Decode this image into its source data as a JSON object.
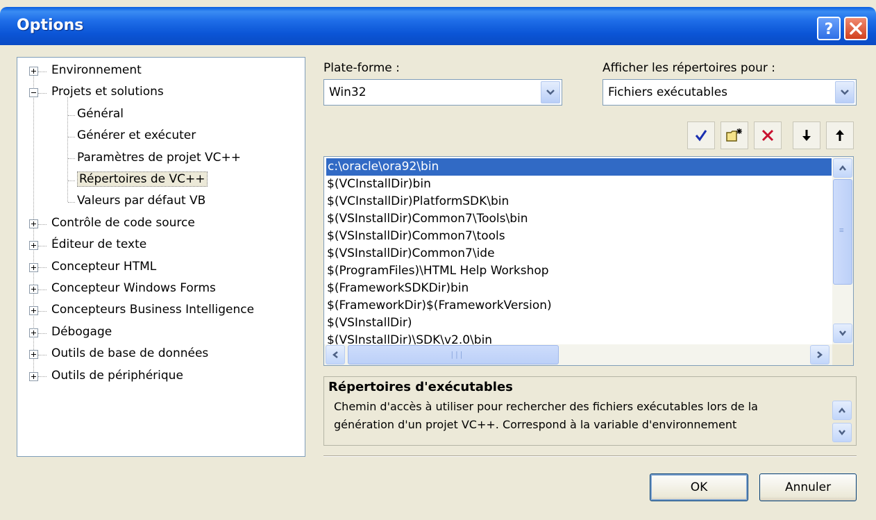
{
  "window": {
    "title": "Options"
  },
  "tree": {
    "items": [
      {
        "label": "Environnement",
        "expander": "plus"
      },
      {
        "label": "Projets et solutions",
        "expander": "minus"
      },
      {
        "label": "Général",
        "expander": "none"
      },
      {
        "label": "Générer et exécuter",
        "expander": "none"
      },
      {
        "label": "Paramètres de projet VC++",
        "expander": "none"
      },
      {
        "label": "Répertoires de VC++",
        "expander": "none",
        "selected": true
      },
      {
        "label": "Valeurs par défaut VB",
        "expander": "none"
      },
      {
        "label": "Contrôle de code source",
        "expander": "plus"
      },
      {
        "label": "Éditeur de texte",
        "expander": "plus"
      },
      {
        "label": "Concepteur HTML",
        "expander": "plus"
      },
      {
        "label": "Concepteur Windows Forms",
        "expander": "plus"
      },
      {
        "label": "Concepteurs Business Intelligence",
        "expander": "plus"
      },
      {
        "label": "Débogage",
        "expander": "plus"
      },
      {
        "label": "Outils de base de données",
        "expander": "plus"
      },
      {
        "label": "Outils de périphérique",
        "expander": "plus"
      }
    ]
  },
  "platform": {
    "label": "Plate-forme :",
    "value": "Win32"
  },
  "show_dirs": {
    "label": "Afficher les répertoires pour :",
    "value": "Fichiers exécutables"
  },
  "directories": [
    "c:\\oracle\\ora92\\bin",
    "$(VCInstallDir)bin",
    "$(VCInstallDir)PlatformSDK\\bin",
    "$(VSInstallDir)Common7\\Tools\\bin",
    "$(VSInstallDir)Common7\\tools",
    "$(VSInstallDir)Common7\\ide",
    "$(ProgramFiles)\\HTML Help Workshop",
    "$(FrameworkSDKDir)bin",
    "$(FrameworkDir)$(FrameworkVersion)",
    "$(VSInstallDir)",
    "$(VSInstallDir)\\SDK\\v2.0\\bin"
  ],
  "description": {
    "title": "Répertoires d'exécutables",
    "line1": "Chemin d'accès à utiliser pour rechercher des fichiers exécutables lors de la",
    "line2": "génération d'un projet VC++. Correspond à la variable d'environnement"
  },
  "buttons": {
    "ok": "OK",
    "cancel": "Annuler"
  },
  "colors": {
    "title_bar": "#0b55d6",
    "selection": "#316ac5",
    "dialog_bg": "#ece9d8"
  }
}
